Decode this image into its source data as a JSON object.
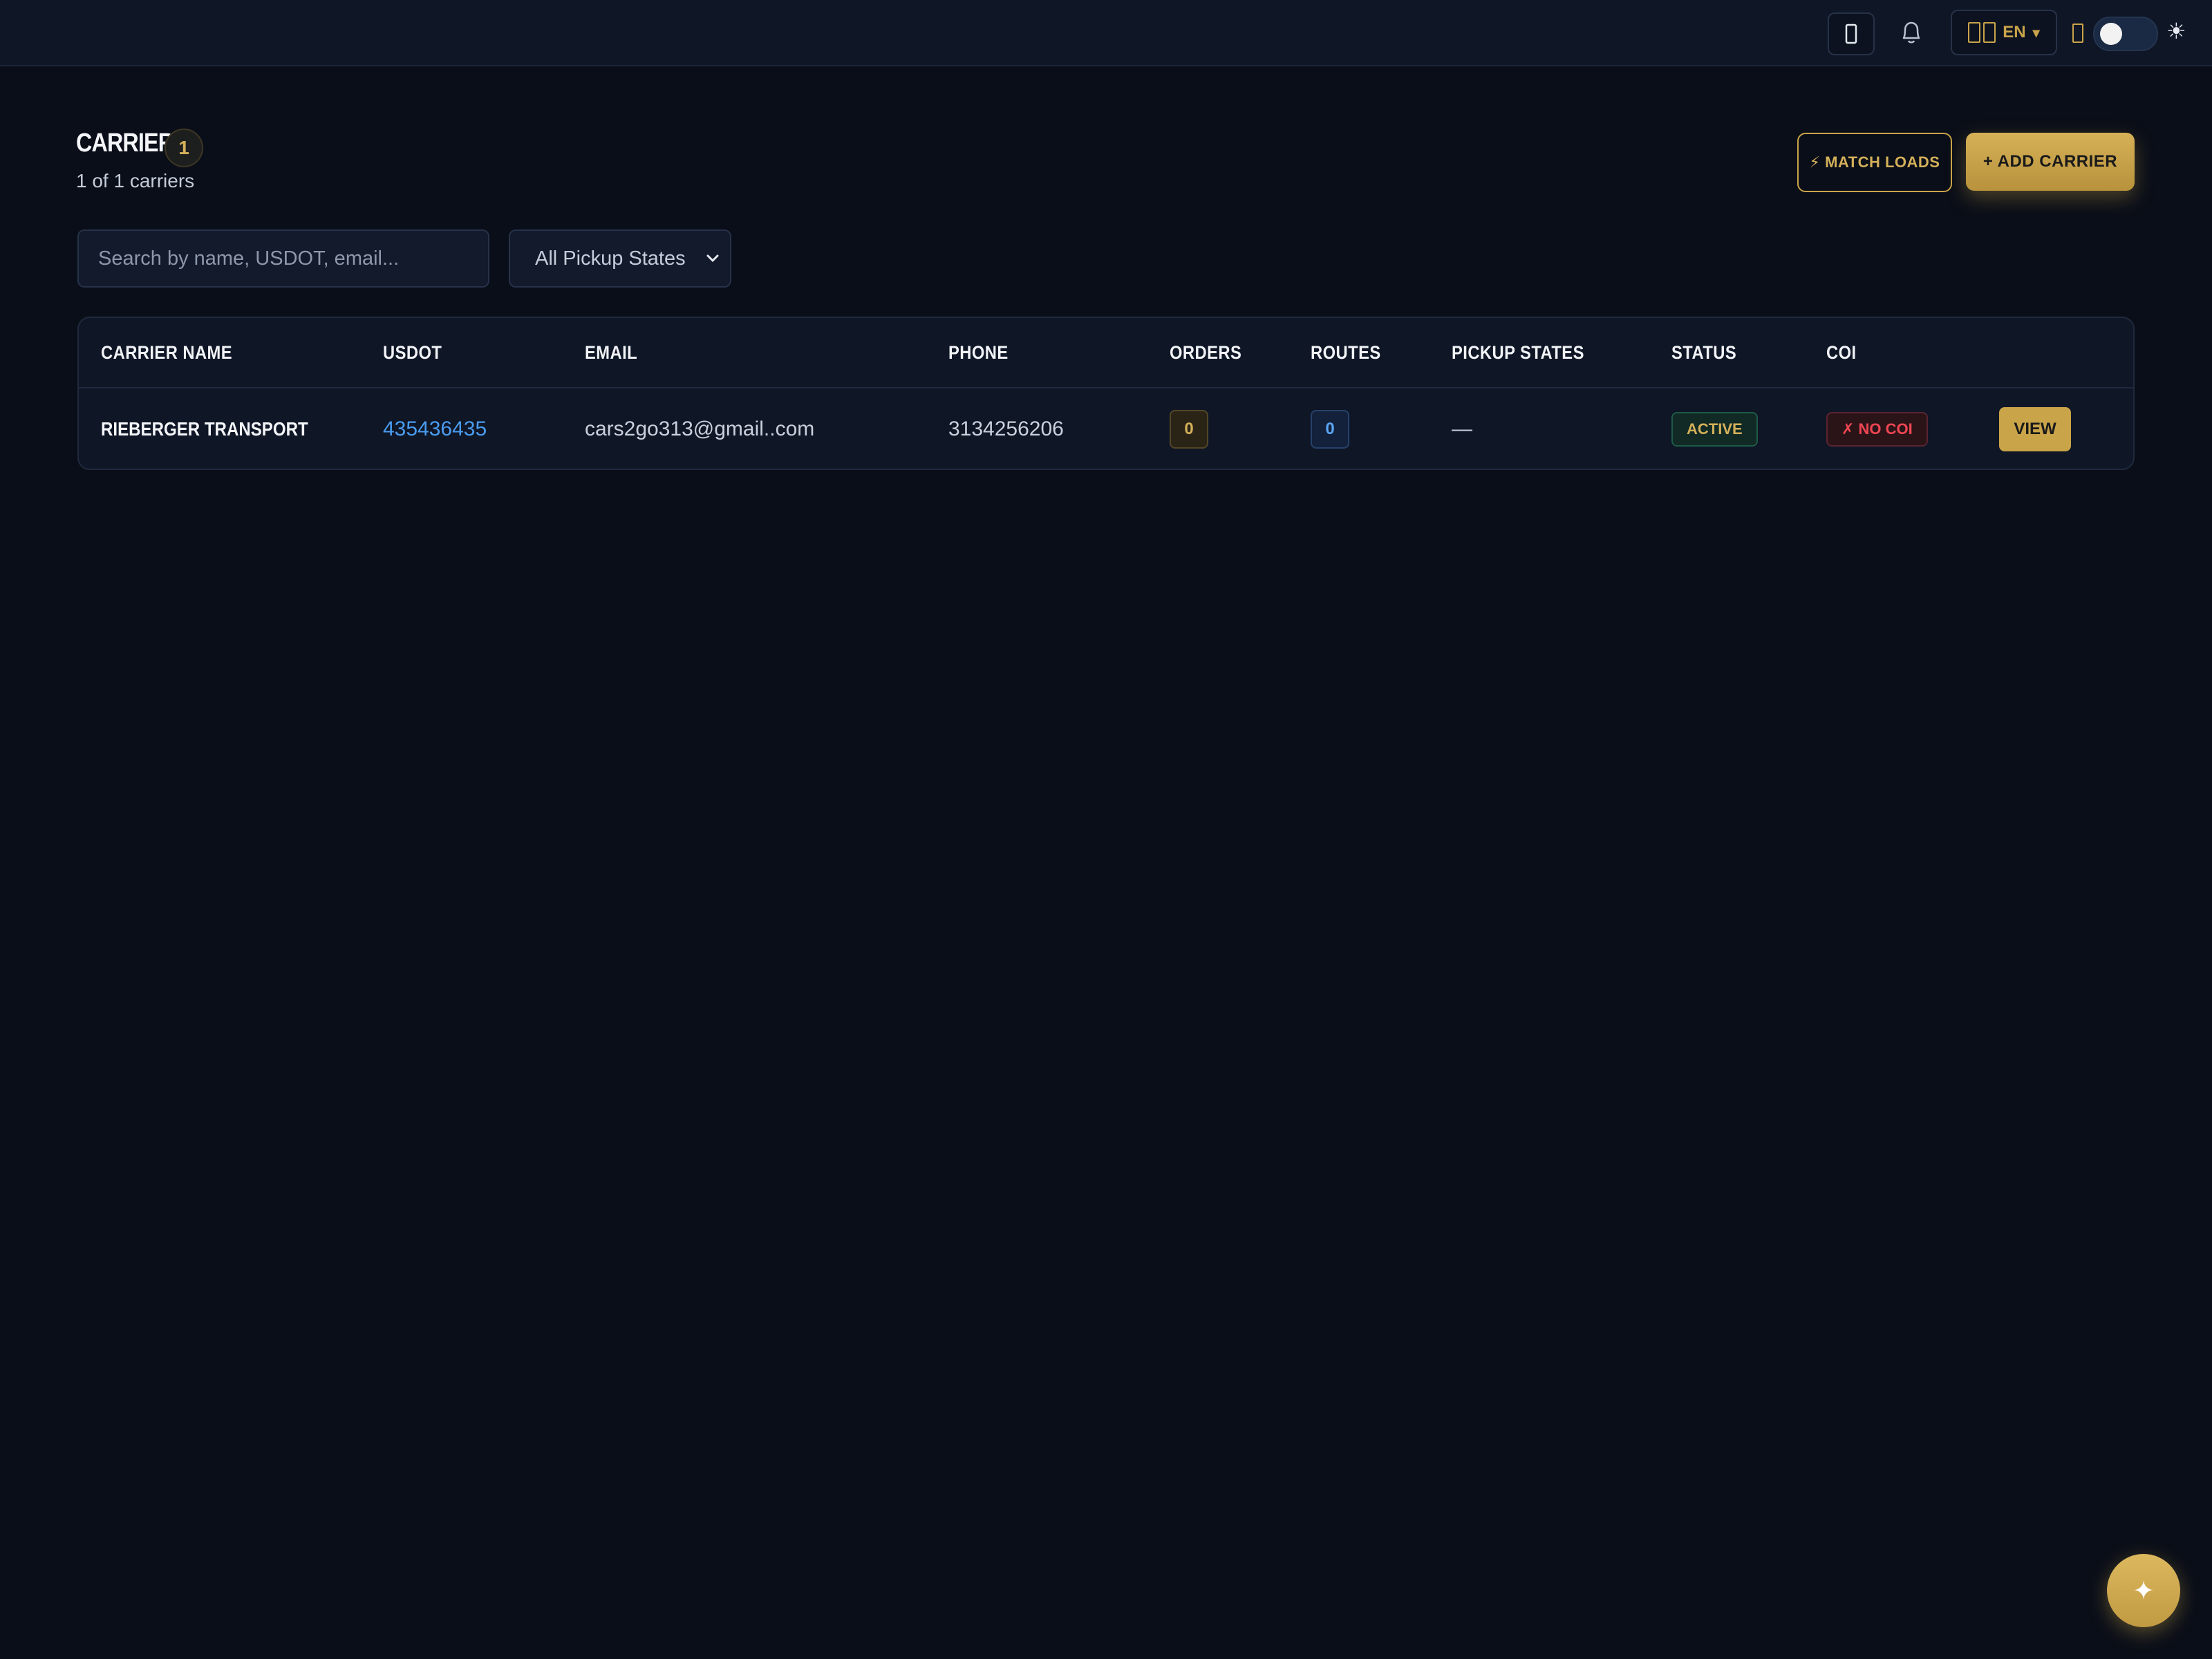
{
  "topbar": {
    "icons": {
      "device": "mobile-icon",
      "bell": "bell-icon",
      "flag": "flag-icon",
      "small": "device-small-icon",
      "sun": "sun-icon"
    },
    "language": {
      "code": "EN",
      "caret": "▾"
    },
    "theme_toggle": {
      "sun_glyph": "☀"
    }
  },
  "header": {
    "title": "CARRIERS",
    "count": "1",
    "subtitle": "1 of 1 carriers",
    "match_loads_label": "⚡ MATCH LOADS",
    "add_carrier_label": "+ ADD CARRIER"
  },
  "filters": {
    "search_placeholder": "Search by name, USDOT, email...",
    "search_value": "",
    "pickup_states": "All Pickup States"
  },
  "table": {
    "columns": [
      "CARRIER NAME",
      "USDOT",
      "EMAIL",
      "PHONE",
      "ORDERS",
      "ROUTES",
      "PICKUP STATES",
      "STATUS",
      "COI"
    ],
    "rows": [
      {
        "name": "RIEBERGER TRANSPORT",
        "usdot": "435436435",
        "email": "cars2go313@gmail..com",
        "phone": "3134256206",
        "orders": "0",
        "routes": "0",
        "pickup_states": "—",
        "status": "ACTIVE",
        "coi": "✗ NO COI",
        "action": "VIEW"
      }
    ]
  },
  "fab": {
    "glyph": "✦"
  },
  "colors": {
    "accent": "#c9a449",
    "background": "#0a0e18",
    "link": "#4a9cf0",
    "danger": "#ef4552"
  }
}
